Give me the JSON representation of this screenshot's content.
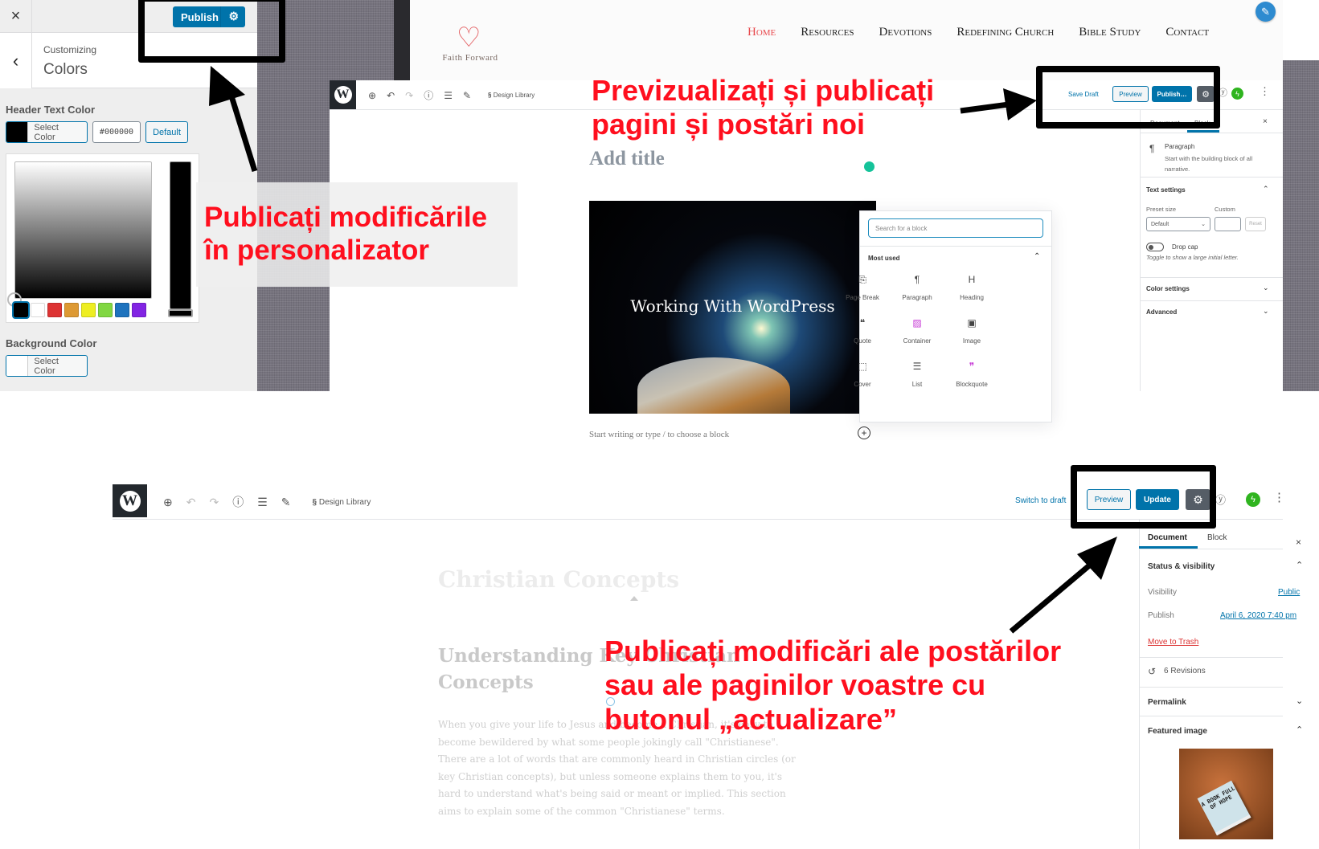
{
  "customizer": {
    "close_icon": "×",
    "publish_label": "Publish",
    "subtitle": "Customizing",
    "title": "Colors",
    "header_text_color": {
      "label": "Header Text Color",
      "select_label": "Select Color",
      "hex_value": "#000000",
      "default_label": "Default",
      "current_color": "#000000"
    },
    "palette": [
      "#000000",
      "#ffffff",
      "#dd3333",
      "#dd9933",
      "#eeee22",
      "#81d742",
      "#1e73be",
      "#8224e3"
    ],
    "background_color": {
      "label": "Background Color",
      "select_label": "Select Color",
      "current_color": "#ffffff"
    }
  },
  "site": {
    "logo_text": "Faith Forward",
    "nav": [
      "Home",
      "Resources",
      "Devotions",
      "Redefining Church",
      "Bible Study",
      "Contact"
    ],
    "active_nav": "Home",
    "accent_color": "#e8484c"
  },
  "editor_new": {
    "toolbar": {
      "design_library": "Design Library",
      "save_draft": "Save Draft",
      "preview": "Preview",
      "publish": "Publish…"
    },
    "title_placeholder": "Add title",
    "cover_title": "Working With WordPress",
    "paragraph_placeholder": "Start writing or type / to choose a block",
    "inserter": {
      "search_placeholder": "Search for a block",
      "section": "Most used",
      "blocks": [
        {
          "label": "Page Break",
          "icon": "⎘"
        },
        {
          "label": "Paragraph",
          "icon": "¶"
        },
        {
          "label": "Heading",
          "icon": "H"
        },
        {
          "label": "Quote",
          "icon": "❝"
        },
        {
          "label": "Container",
          "icon": "▨"
        },
        {
          "label": "Image",
          "icon": "▣"
        },
        {
          "label": "Cover",
          "icon": "⬚"
        },
        {
          "label": "List",
          "icon": "☰"
        },
        {
          "label": "Blockquote",
          "icon": "❞"
        }
      ]
    },
    "sidebar": {
      "tabs": [
        "Document",
        "Block"
      ],
      "active_tab": "Block",
      "block_name": "Paragraph",
      "block_description": "Start with the building block of all narrative.",
      "text_settings": "Text settings",
      "preset_size_label": "Preset size",
      "preset_size_value": "Default",
      "custom_label": "Custom",
      "reset_label": "Reset",
      "drop_cap_label": "Drop cap",
      "drop_cap_help": "Toggle to show a large initial letter.",
      "color_settings": "Color settings",
      "advanced": "Advanced"
    }
  },
  "editor_existing": {
    "toolbar": {
      "design_library": "Design Library",
      "switch_to_draft": "Switch to draft",
      "preview": "Preview",
      "update": "Update"
    },
    "post_title": "Christian Concepts",
    "heading": "Understanding Key Christian Concepts",
    "body": "When you give your life to Jesus and become a Christian, it's easy to become bewildered by what some people jokingly call \"Christianese\". There are a lot of words that are commonly heard in Christian circles (or key Christian concepts), but unless someone explains them to you, it's hard to understand what's being said or meant or implied. This section aims to explain some of the common \"Christianese\" terms.",
    "sidebar": {
      "tabs": [
        "Document",
        "Block"
      ],
      "active_tab": "Document",
      "status_visibility": "Status & visibility",
      "visibility_label": "Visibility",
      "visibility_value": "Public",
      "publish_label": "Publish",
      "publish_value": "April 6, 2020 7:40 pm",
      "move_to_trash": "Move to Trash",
      "revisions": "6 Revisions",
      "permalink": "Permalink",
      "featured_image": "Featured image",
      "featured_image_text": "A BOOK FULL OF HOPE"
    }
  },
  "annotations": {
    "customizer": "Publicați modificările în personalizator",
    "new_content": "Previzualizați și publicați pagini și postări noi",
    "update": "Publicați modificări ale postărilor sau ale paginilor voastre cu butonul „actualizare”",
    "color": "#ff0f1e"
  }
}
